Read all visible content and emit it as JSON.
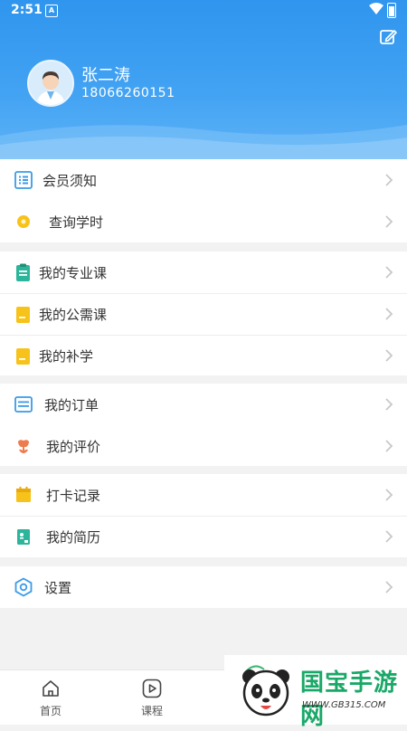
{
  "status": {
    "time": "2:51",
    "notif": "A"
  },
  "user": {
    "name": "张二涛",
    "phone": "18066260151"
  },
  "menu": {
    "member_notice": "会员须知",
    "query_hours": "查询学时",
    "my_professional": "我的专业课",
    "my_public": "我的公需课",
    "my_makeup": "我的补学",
    "my_orders": "我的订单",
    "my_reviews": "我的评价",
    "checkin_records": "打卡记录",
    "my_resume": "我的简历",
    "settings": "设置"
  },
  "nav": {
    "home": "首页",
    "course": "课程"
  },
  "watermark": {
    "text": "国宝手游网",
    "url": "WWW.GB315.COM"
  },
  "icons": [
    "edit-icon",
    "list-icon",
    "coin-icon",
    "clipboard-icon",
    "book-icon",
    "order-icon",
    "flower-icon",
    "calendar-icon",
    "resume-icon",
    "hexagon-settings-icon",
    "home-icon",
    "play-icon",
    "panda-logo"
  ],
  "colors": {
    "header": "#2f95ee",
    "accent_blue": "#3a9be8",
    "green": "#2bb59a",
    "yellow": "#f7c31a",
    "orange": "#ee7b4e",
    "watermark_green": "#1aa868"
  }
}
